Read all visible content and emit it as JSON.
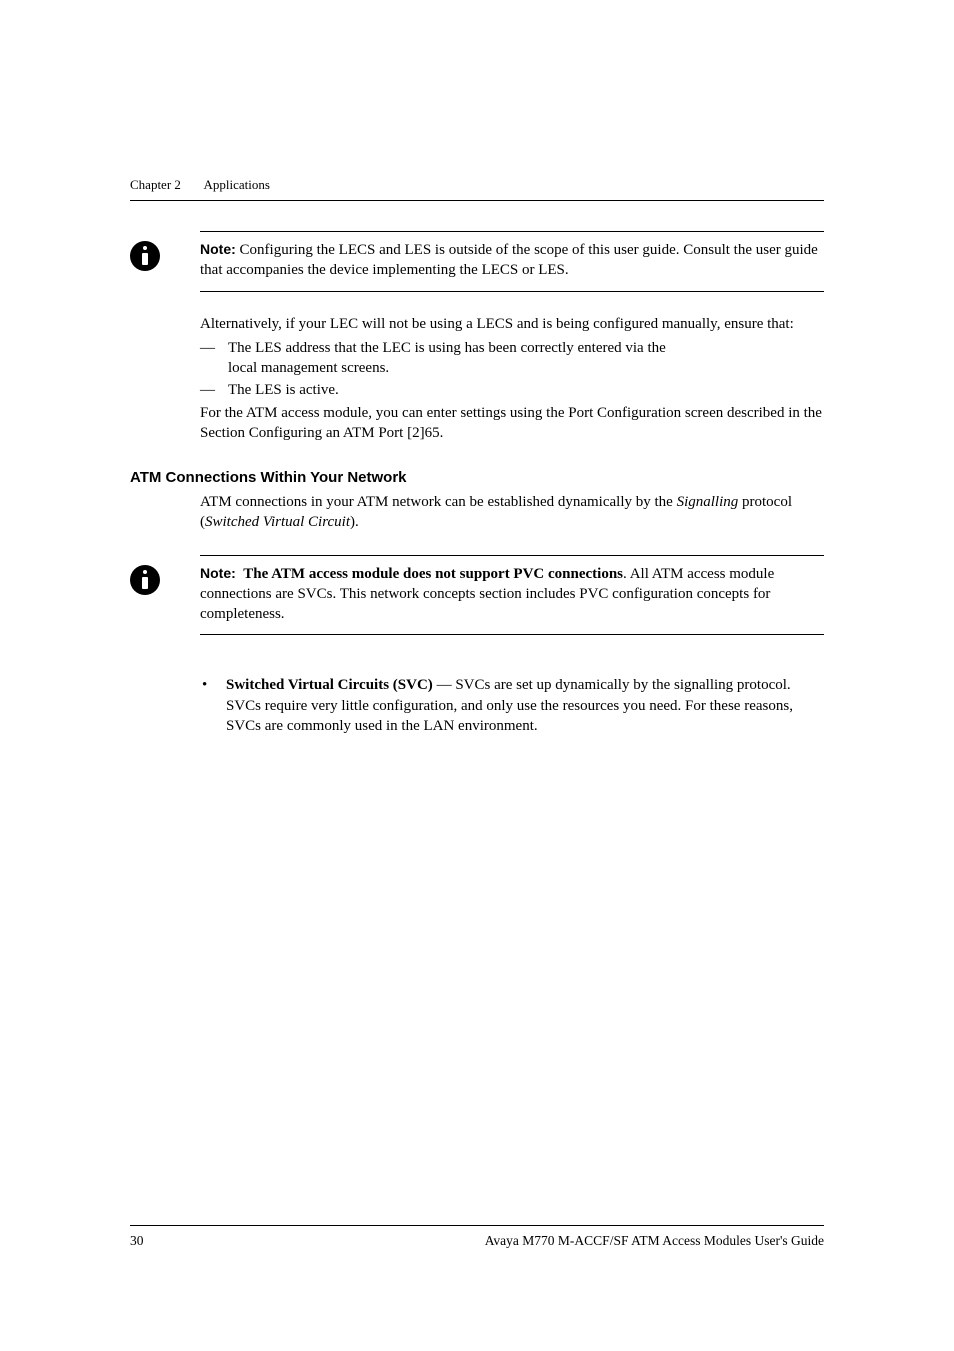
{
  "header": {
    "chapter_label": "Chapter 2",
    "chapter_title": "Applications"
  },
  "note1": {
    "label": "Note:",
    "text": "Configuring the LECS and LES is outside of the scope of this user guide. Consult the user guide that accompanies the device implementing the LECS or LES."
  },
  "alt_intro": "Alternatively, if your LEC will not be using a LECS and is being configured manually, ensure that:",
  "alt_items": {
    "i0a": "The LES address that the LEC is using has been correctly entered via the",
    "i0b": "local management screens.",
    "i1": "The LES is active."
  },
  "alt_closing": "For the ATM access module, you can enter settings using the Port Configuration screen described in the Section Configuring an ATM Port [2]65.",
  "section_heading": "ATM Connections Within Your Network",
  "section_body": {
    "pre": "ATM connections in your ATM network can be established dynamically by the ",
    "sig": "Signalling",
    "mid": " protocol (",
    "svc": "Switched Virtual Circuit",
    "post": ")."
  },
  "note2": {
    "label": "Note:",
    "bold": "The ATM access module does not support PVC connections",
    "rest": ". All ATM access module connections are SVCs. This network concepts section includes PVC configuration concepts for completeness."
  },
  "svc_bullet": {
    "title": "Switched Virtual Circuits (SVC)",
    "rest": " — SVCs are set up dynamically by the signalling protocol. SVCs require very little configuration, and only use the resources you need. For these reasons, SVCs are commonly used in the LAN environment."
  },
  "footer": {
    "page": "30",
    "title": "Avaya M770 M-ACCF/SF ATM Access Modules User's Guide"
  }
}
